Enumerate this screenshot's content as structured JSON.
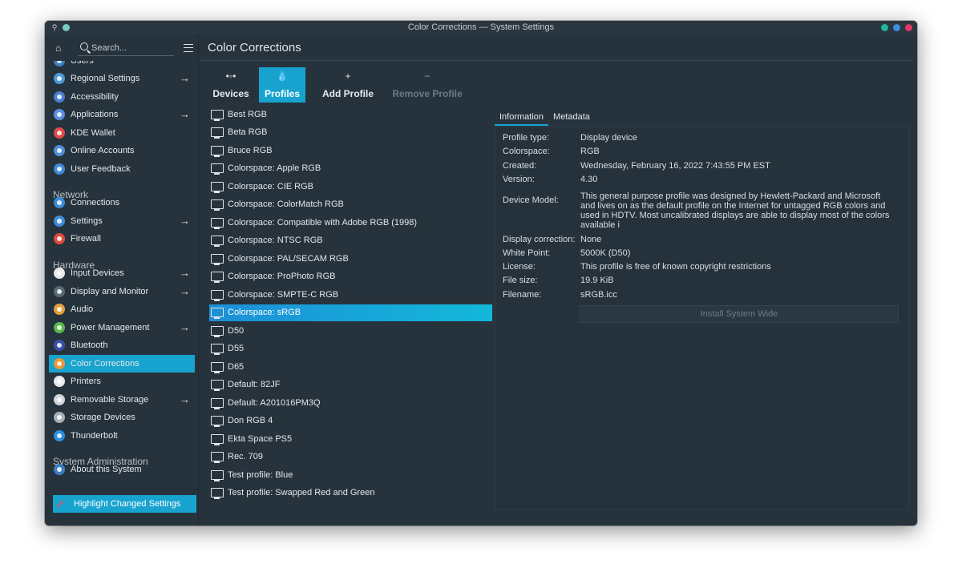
{
  "window": {
    "title": "Color Corrections — System Settings",
    "button_colors": [
      "#1fb89a",
      "#3a8fd9",
      "#e0366a"
    ]
  },
  "sidebar": {
    "search_placeholder": "Search...",
    "items": [
      {
        "label": "Users",
        "icon": "users-icon",
        "color": "#3d7fc1",
        "arrow": false
      },
      {
        "label": "Regional Settings",
        "icon": "globe-icon",
        "color": "#4c9ad8",
        "arrow": true
      },
      {
        "label": "Accessibility",
        "icon": "accessibility-icon",
        "color": "#4a7fd0",
        "arrow": false
      },
      {
        "label": "Applications",
        "icon": "applications-icon",
        "color": "#5e8fe0",
        "arrow": true
      },
      {
        "label": "KDE Wallet",
        "icon": "wallet-icon",
        "color": "#e04a4a",
        "arrow": false
      },
      {
        "label": "Online Accounts",
        "icon": "online-accounts-icon",
        "color": "#4e8fd8",
        "arrow": false
      },
      {
        "label": "User Feedback",
        "icon": "feedback-icon",
        "color": "#3f8ad8",
        "arrow": false
      },
      {
        "label": "Connections",
        "icon": "connections-icon",
        "color": "#3d8dd5",
        "arrow": false
      },
      {
        "label": "Settings",
        "icon": "network-settings-icon",
        "color": "#3d8dd5",
        "arrow": true
      },
      {
        "label": "Firewall",
        "icon": "firewall-icon",
        "color": "#e04a3a",
        "arrow": false
      },
      {
        "label": "Input Devices",
        "icon": "mouse-icon",
        "color": "#e8e8e8",
        "arrow": true
      },
      {
        "label": "Display and Monitor",
        "icon": "display-icon",
        "color": "#5a6a74",
        "arrow": true
      },
      {
        "label": "Audio",
        "icon": "speaker-icon",
        "color": "#e0a040",
        "arrow": false
      },
      {
        "label": "Power Management",
        "icon": "battery-icon",
        "color": "#58b84a",
        "arrow": true
      },
      {
        "label": "Bluetooth",
        "icon": "bluetooth-icon",
        "color": "#3a4fa8",
        "arrow": false
      },
      {
        "label": "Color Corrections",
        "icon": "color-wheel-icon",
        "color": "#e89a3a",
        "arrow": false,
        "selected": true
      },
      {
        "label": "Printers",
        "icon": "printer-icon",
        "color": "#e8e8e8",
        "arrow": false
      },
      {
        "label": "Removable Storage",
        "icon": "usb-drive-icon",
        "color": "#cfd5da",
        "arrow": true
      },
      {
        "label": "Storage Devices",
        "icon": "hard-drive-icon",
        "color": "#a8b0b6",
        "arrow": false
      },
      {
        "label": "Thunderbolt",
        "icon": "thunderbolt-icon",
        "color": "#2d8fe0",
        "arrow": false
      },
      {
        "label": "About this System",
        "icon": "info-icon",
        "color": "#3d7fc1",
        "arrow": false
      }
    ],
    "categories": {
      "network": "Network",
      "hardware": "Hardware",
      "system_administration": "System Administration"
    },
    "highlight_button": "Highlight Changed Settings"
  },
  "main": {
    "page_title": "Color Corrections",
    "toolbar": [
      {
        "label": "Devices",
        "glyph": "•◦•"
      },
      {
        "label": "Profiles",
        "glyph": "💧"
      },
      {
        "label": "Add Profile",
        "glyph": "+"
      },
      {
        "label": "Remove Profile",
        "glyph": "−"
      }
    ],
    "profiles": [
      "Best RGB",
      "Beta RGB",
      "Bruce RGB",
      "Colorspace: Apple RGB",
      "Colorspace: CIE RGB",
      "Colorspace: ColorMatch RGB",
      "Colorspace: Compatible with Adobe RGB (1998)",
      "Colorspace: NTSC RGB",
      "Colorspace: PAL/SECAM RGB",
      "Colorspace: ProPhoto RGB",
      "Colorspace: SMPTE-C RGB",
      "Colorspace: sRGB",
      "D50",
      "D55",
      "D65",
      "Default: 82JF",
      "Default: A201016PM3Q",
      "Don RGB 4",
      "Ekta Space PS5",
      "Rec. 709",
      "Test profile: Blue",
      "Test profile: Swapped Red and Green"
    ],
    "selected_profile": "Colorspace: sRGB",
    "info_tabs": [
      "Information",
      "Metadata"
    ],
    "info": {
      "profile_type": {
        "key": "Profile type:",
        "value": "Display device"
      },
      "colorspace": {
        "key": "Colorspace:",
        "value": "RGB"
      },
      "created": {
        "key": "Created:",
        "value": "Wednesday, February 16, 2022 7:43:55 PM EST"
      },
      "version": {
        "key": "Version:",
        "value": "4.30"
      },
      "device_model": {
        "key": "Device Model:",
        "value": "This general purpose profile was designed by Hewlett-Packard and Microsoft and lives on as the default profile on the Internet for untagged RGB colors and used in HDTV. Most uncalibrated displays are able to display most of the colors available i"
      },
      "display_correction": {
        "key": "Display correction:",
        "value": "None"
      },
      "white_point": {
        "key": "White Point:",
        "value": "5000K (D50)"
      },
      "license": {
        "key": "License:",
        "value": "This profile is free of known copyright restrictions"
      },
      "file_size": {
        "key": "File size:",
        "value": "19.9 KiB"
      },
      "filename": {
        "key": "Filename:",
        "value": "sRGB.icc"
      }
    },
    "install_button": "Install System Wide"
  }
}
